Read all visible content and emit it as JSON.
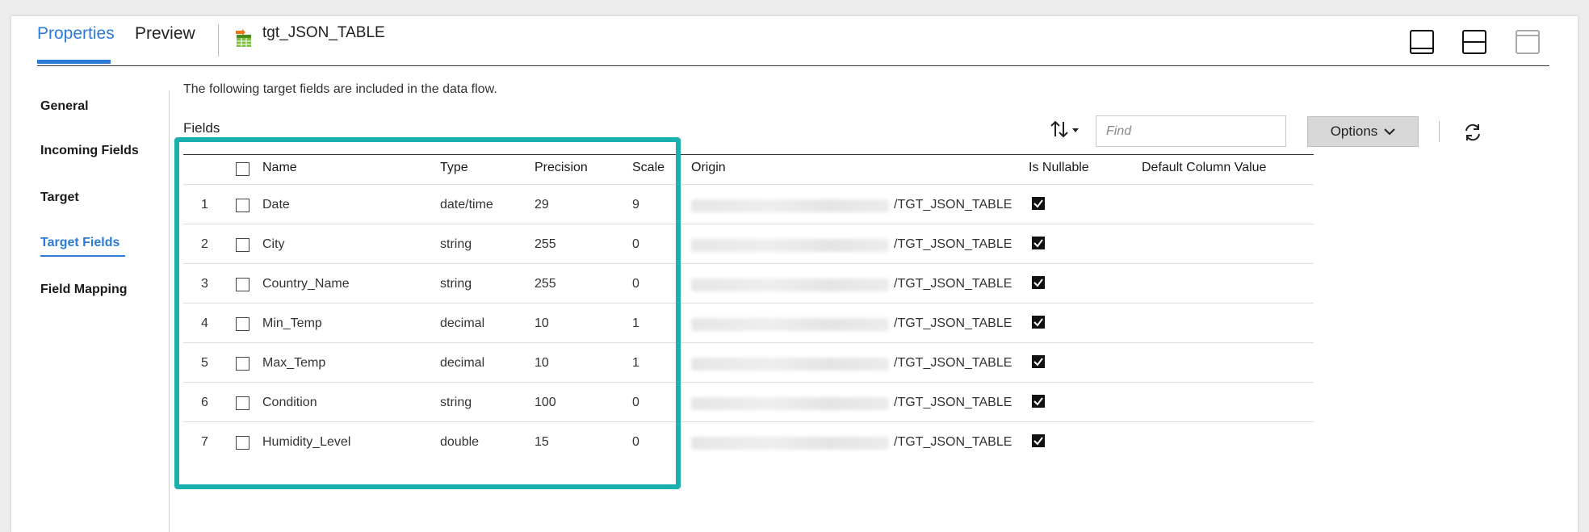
{
  "tabs": [
    {
      "label": "Properties",
      "active": true
    },
    {
      "label": "Preview",
      "active": false
    }
  ],
  "object": {
    "title": "tgt_JSON_TABLE",
    "icon": "table-target-icon"
  },
  "layout_buttons": [
    "layout-bottom-icon",
    "layout-split-icon",
    "layout-top-icon"
  ],
  "nav": [
    {
      "label": "General",
      "active": false
    },
    {
      "label": "Incoming Fields",
      "active": false
    },
    {
      "label": "Target",
      "active": false
    },
    {
      "label": "Target Fields",
      "active": true
    },
    {
      "label": "Field Mapping",
      "active": false
    }
  ],
  "main": {
    "description": "The following target fields are included in the data flow.",
    "fields_label": "Fields",
    "find_placeholder": "Find",
    "options_label": "Options"
  },
  "table": {
    "headers": {
      "name": "Name",
      "type": "Type",
      "precision": "Precision",
      "scale": "Scale",
      "origin": "Origin",
      "nullable": "Is Nullable",
      "default": "Default Column Value"
    },
    "rows": [
      {
        "num": "1",
        "name": "Date",
        "type": "date/time",
        "precision": "29",
        "scale": "9",
        "origin": "/TGT_JSON_TABLE",
        "nullable": true
      },
      {
        "num": "2",
        "name": "City",
        "type": "string",
        "precision": "255",
        "scale": "0",
        "origin": "/TGT_JSON_TABLE",
        "nullable": true
      },
      {
        "num": "3",
        "name": "Country_Name",
        "type": "string",
        "precision": "255",
        "scale": "0",
        "origin": "/TGT_JSON_TABLE",
        "nullable": true
      },
      {
        "num": "4",
        "name": "Min_Temp",
        "type": "decimal",
        "precision": "10",
        "scale": "1",
        "origin": "/TGT_JSON_TABLE",
        "nullable": true
      },
      {
        "num": "5",
        "name": "Max_Temp",
        "type": "decimal",
        "precision": "10",
        "scale": "1",
        "origin": "/TGT_JSON_TABLE",
        "nullable": true
      },
      {
        "num": "6",
        "name": "Condition",
        "type": "string",
        "precision": "100",
        "scale": "0",
        "origin": "/TGT_JSON_TABLE",
        "nullable": true
      },
      {
        "num": "7",
        "name": "Humidity_Level",
        "type": "double",
        "precision": "15",
        "scale": "0",
        "origin": "/TGT_JSON_TABLE",
        "nullable": true
      }
    ]
  },
  "colors": {
    "accent": "#2b7bd6",
    "highlight": "#19b0ad",
    "options_bg": "#d7d7d7"
  }
}
